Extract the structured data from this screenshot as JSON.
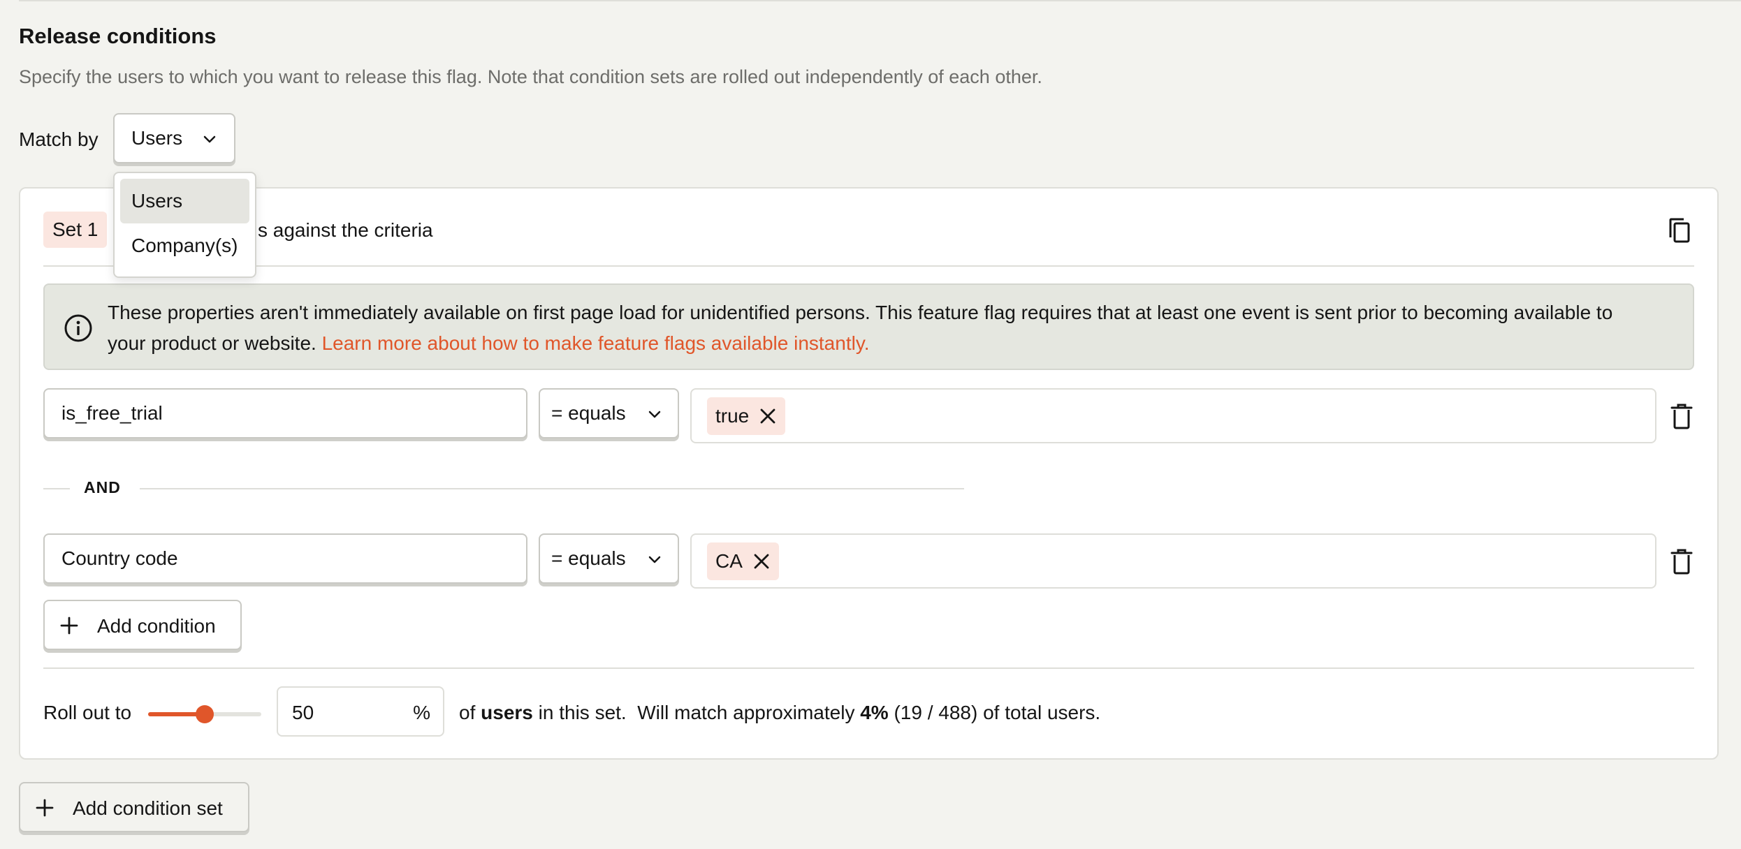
{
  "section": {
    "title": "Release conditions",
    "description": "Specify the users to which you want to release this flag. Note that condition sets are rolled out independently of each other."
  },
  "match_by": {
    "label": "Match by",
    "selected": "Users",
    "options": [
      "Users",
      "Company(s)"
    ]
  },
  "condition_set": {
    "badge": "Set 1",
    "header_text_visible": "s against the criteria",
    "info": {
      "text": "These properties aren't immediately available on first page load for unidentified persons. This feature flag requires that at least one event is sent prior to becoming available to your product or website.",
      "link": "Learn more about how to make feature flags available instantly."
    },
    "conditions": [
      {
        "property": "is_free_trial",
        "operator": "= equals",
        "values": [
          "true"
        ]
      },
      {
        "property": "Country code",
        "operator": "= equals",
        "values": [
          "CA"
        ]
      }
    ],
    "and_label": "AND",
    "add_condition_label": "Add condition",
    "rollout": {
      "label": "Roll out to",
      "percent": 50,
      "percent_symbol": "%",
      "text_of": "of ",
      "text_users": "users",
      "text_in_set": " in this set.  Will match approximately ",
      "match_pct": "4%",
      "match_detail": " (19 / 488) of total users."
    }
  },
  "add_condition_set_label": "Add condition set",
  "colors": {
    "accent": "#e0562a",
    "chip_bg": "#fbe6e0",
    "info_bg": "#e5e7e0",
    "page_bg": "#f3f3ef"
  }
}
